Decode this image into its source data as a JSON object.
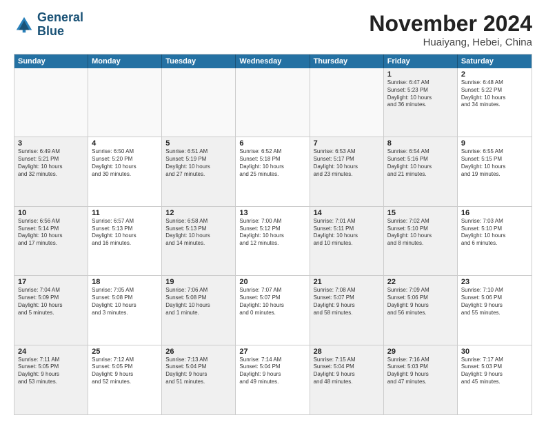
{
  "logo": {
    "line1": "General",
    "line2": "Blue"
  },
  "title": "November 2024",
  "location": "Huaiyang, Hebei, China",
  "days_of_week": [
    "Sunday",
    "Monday",
    "Tuesday",
    "Wednesday",
    "Thursday",
    "Friday",
    "Saturday"
  ],
  "weeks": [
    [
      {
        "day": "",
        "text": "",
        "empty": true
      },
      {
        "day": "",
        "text": "",
        "empty": true
      },
      {
        "day": "",
        "text": "",
        "empty": true
      },
      {
        "day": "",
        "text": "",
        "empty": true
      },
      {
        "day": "",
        "text": "",
        "empty": true
      },
      {
        "day": "1",
        "text": "Sunrise: 6:47 AM\nSunset: 5:23 PM\nDaylight: 10 hours\nand 36 minutes.",
        "shaded": true
      },
      {
        "day": "2",
        "text": "Sunrise: 6:48 AM\nSunset: 5:22 PM\nDaylight: 10 hours\nand 34 minutes."
      }
    ],
    [
      {
        "day": "3",
        "text": "Sunrise: 6:49 AM\nSunset: 5:21 PM\nDaylight: 10 hours\nand 32 minutes.",
        "shaded": true
      },
      {
        "day": "4",
        "text": "Sunrise: 6:50 AM\nSunset: 5:20 PM\nDaylight: 10 hours\nand 30 minutes."
      },
      {
        "day": "5",
        "text": "Sunrise: 6:51 AM\nSunset: 5:19 PM\nDaylight: 10 hours\nand 27 minutes.",
        "shaded": true
      },
      {
        "day": "6",
        "text": "Sunrise: 6:52 AM\nSunset: 5:18 PM\nDaylight: 10 hours\nand 25 minutes."
      },
      {
        "day": "7",
        "text": "Sunrise: 6:53 AM\nSunset: 5:17 PM\nDaylight: 10 hours\nand 23 minutes.",
        "shaded": true
      },
      {
        "day": "8",
        "text": "Sunrise: 6:54 AM\nSunset: 5:16 PM\nDaylight: 10 hours\nand 21 minutes.",
        "shaded": true
      },
      {
        "day": "9",
        "text": "Sunrise: 6:55 AM\nSunset: 5:15 PM\nDaylight: 10 hours\nand 19 minutes."
      }
    ],
    [
      {
        "day": "10",
        "text": "Sunrise: 6:56 AM\nSunset: 5:14 PM\nDaylight: 10 hours\nand 17 minutes.",
        "shaded": true
      },
      {
        "day": "11",
        "text": "Sunrise: 6:57 AM\nSunset: 5:13 PM\nDaylight: 10 hours\nand 16 minutes."
      },
      {
        "day": "12",
        "text": "Sunrise: 6:58 AM\nSunset: 5:13 PM\nDaylight: 10 hours\nand 14 minutes.",
        "shaded": true
      },
      {
        "day": "13",
        "text": "Sunrise: 7:00 AM\nSunset: 5:12 PM\nDaylight: 10 hours\nand 12 minutes."
      },
      {
        "day": "14",
        "text": "Sunrise: 7:01 AM\nSunset: 5:11 PM\nDaylight: 10 hours\nand 10 minutes.",
        "shaded": true
      },
      {
        "day": "15",
        "text": "Sunrise: 7:02 AM\nSunset: 5:10 PM\nDaylight: 10 hours\nand 8 minutes.",
        "shaded": true
      },
      {
        "day": "16",
        "text": "Sunrise: 7:03 AM\nSunset: 5:10 PM\nDaylight: 10 hours\nand 6 minutes."
      }
    ],
    [
      {
        "day": "17",
        "text": "Sunrise: 7:04 AM\nSunset: 5:09 PM\nDaylight: 10 hours\nand 5 minutes.",
        "shaded": true
      },
      {
        "day": "18",
        "text": "Sunrise: 7:05 AM\nSunset: 5:08 PM\nDaylight: 10 hours\nand 3 minutes."
      },
      {
        "day": "19",
        "text": "Sunrise: 7:06 AM\nSunset: 5:08 PM\nDaylight: 10 hours\nand 1 minute.",
        "shaded": true
      },
      {
        "day": "20",
        "text": "Sunrise: 7:07 AM\nSunset: 5:07 PM\nDaylight: 10 hours\nand 0 minutes."
      },
      {
        "day": "21",
        "text": "Sunrise: 7:08 AM\nSunset: 5:07 PM\nDaylight: 9 hours\nand 58 minutes.",
        "shaded": true
      },
      {
        "day": "22",
        "text": "Sunrise: 7:09 AM\nSunset: 5:06 PM\nDaylight: 9 hours\nand 56 minutes.",
        "shaded": true
      },
      {
        "day": "23",
        "text": "Sunrise: 7:10 AM\nSunset: 5:06 PM\nDaylight: 9 hours\nand 55 minutes."
      }
    ],
    [
      {
        "day": "24",
        "text": "Sunrise: 7:11 AM\nSunset: 5:05 PM\nDaylight: 9 hours\nand 53 minutes.",
        "shaded": true
      },
      {
        "day": "25",
        "text": "Sunrise: 7:12 AM\nSunset: 5:05 PM\nDaylight: 9 hours\nand 52 minutes."
      },
      {
        "day": "26",
        "text": "Sunrise: 7:13 AM\nSunset: 5:04 PM\nDaylight: 9 hours\nand 51 minutes.",
        "shaded": true
      },
      {
        "day": "27",
        "text": "Sunrise: 7:14 AM\nSunset: 5:04 PM\nDaylight: 9 hours\nand 49 minutes."
      },
      {
        "day": "28",
        "text": "Sunrise: 7:15 AM\nSunset: 5:04 PM\nDaylight: 9 hours\nand 48 minutes.",
        "shaded": true
      },
      {
        "day": "29",
        "text": "Sunrise: 7:16 AM\nSunset: 5:03 PM\nDaylight: 9 hours\nand 47 minutes.",
        "shaded": true
      },
      {
        "day": "30",
        "text": "Sunrise: 7:17 AM\nSunset: 5:03 PM\nDaylight: 9 hours\nand 45 minutes."
      }
    ]
  ]
}
